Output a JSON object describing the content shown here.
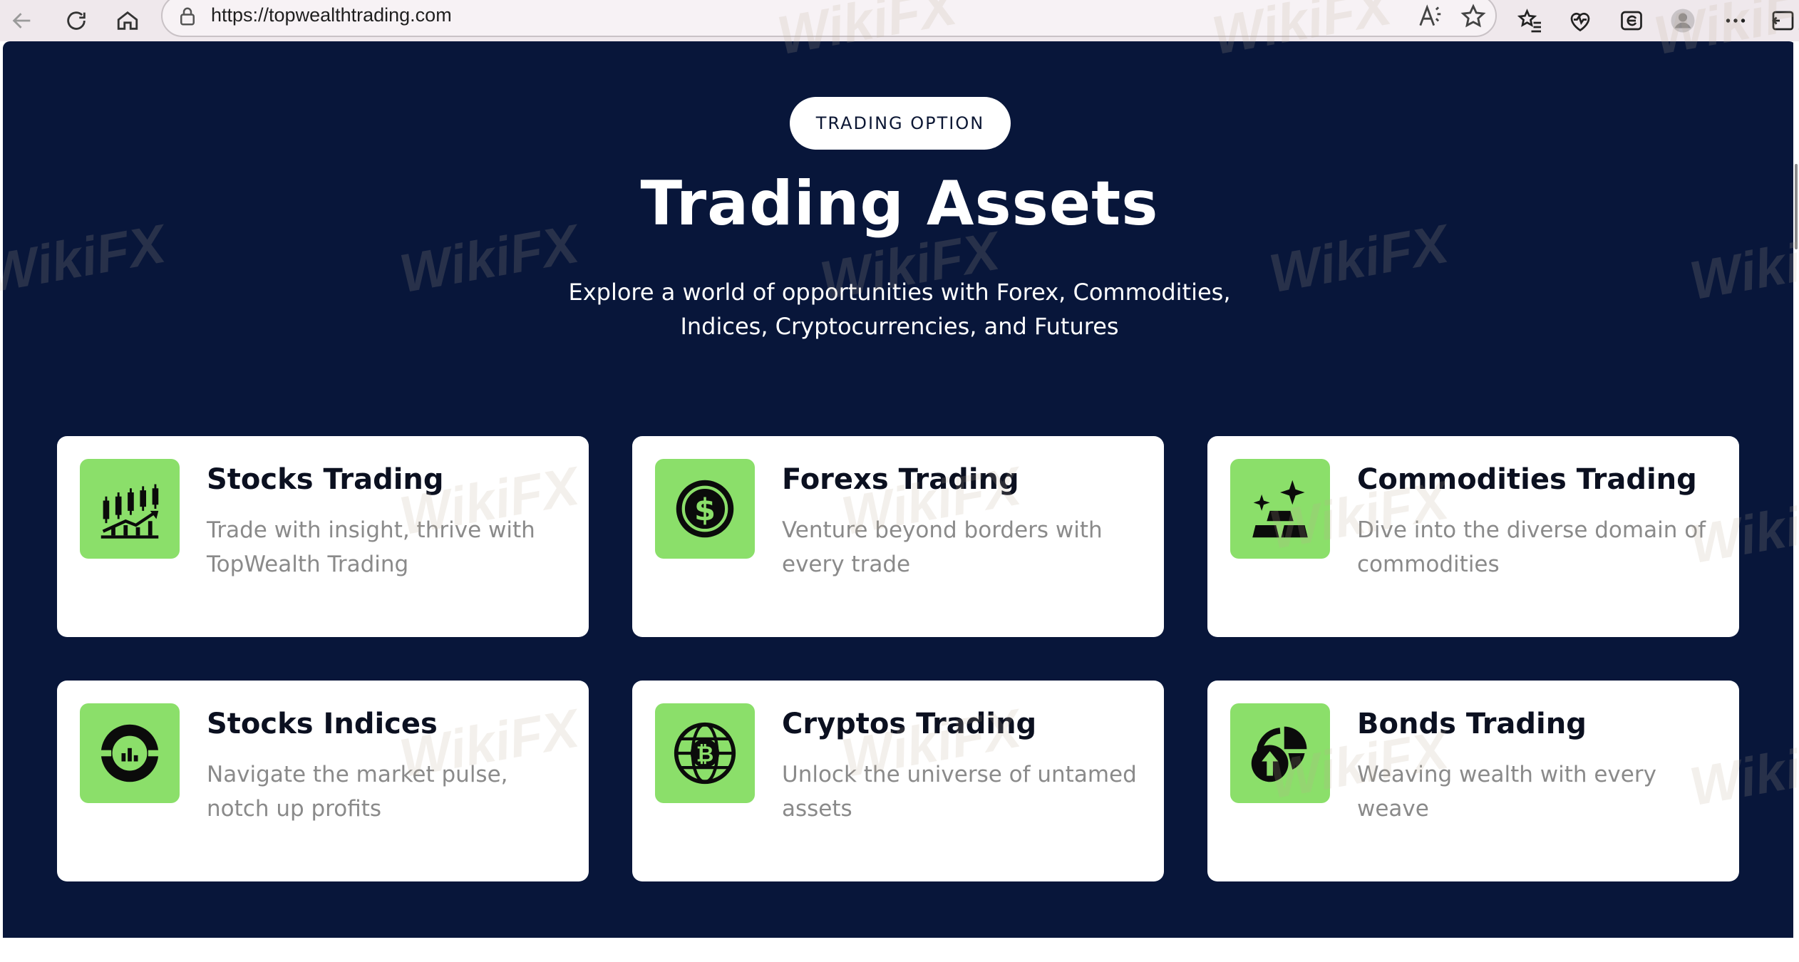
{
  "browser": {
    "url": "https://topwealthtrading.com",
    "icons": [
      "back-icon",
      "refresh-icon",
      "home-icon",
      "lock-icon",
      "read-aloud-icon",
      "favorite-star-icon",
      "favorites-list-icon",
      "browser-essentials-icon",
      "collections-icon",
      "profile-avatar-icon",
      "more-options-icon",
      "sidebar-icon"
    ]
  },
  "hero": {
    "badge": "TRADING OPTION",
    "title": "Trading Assets",
    "subtitle_line1": "Explore a world of opportunities with Forex, Commodities,",
    "subtitle_line2": "Indices, Cryptocurrencies, and Futures"
  },
  "cards": [
    {
      "title": "Stocks Trading",
      "desc": "Trade with insight, thrive with TopWealth Trading",
      "icon": "stock-chart-icon"
    },
    {
      "title": "Forexs Trading",
      "desc": "Venture beyond borders with every trade",
      "icon": "dollar-coin-icon"
    },
    {
      "title": "Commodities Trading",
      "desc": "Dive into the diverse domain of commodities",
      "icon": "gold-bars-icon"
    },
    {
      "title": "Stocks Indices",
      "desc": "Navigate the market pulse, notch up profits",
      "icon": "index-gauge-icon"
    },
    {
      "title": "Cryptos Trading",
      "desc": "Unlock the universe of untamed assets",
      "icon": "bitcoin-globe-icon"
    },
    {
      "title": "Bonds Trading",
      "desc": "Weaving wealth with every weave",
      "icon": "bond-growth-icon"
    }
  ],
  "watermark": "WikiFX",
  "colors": {
    "page_bg": "#08163a",
    "icon_bg": "#8bdf6a",
    "card_bg": "#ffffff",
    "desc_text": "#8a8a8a"
  }
}
